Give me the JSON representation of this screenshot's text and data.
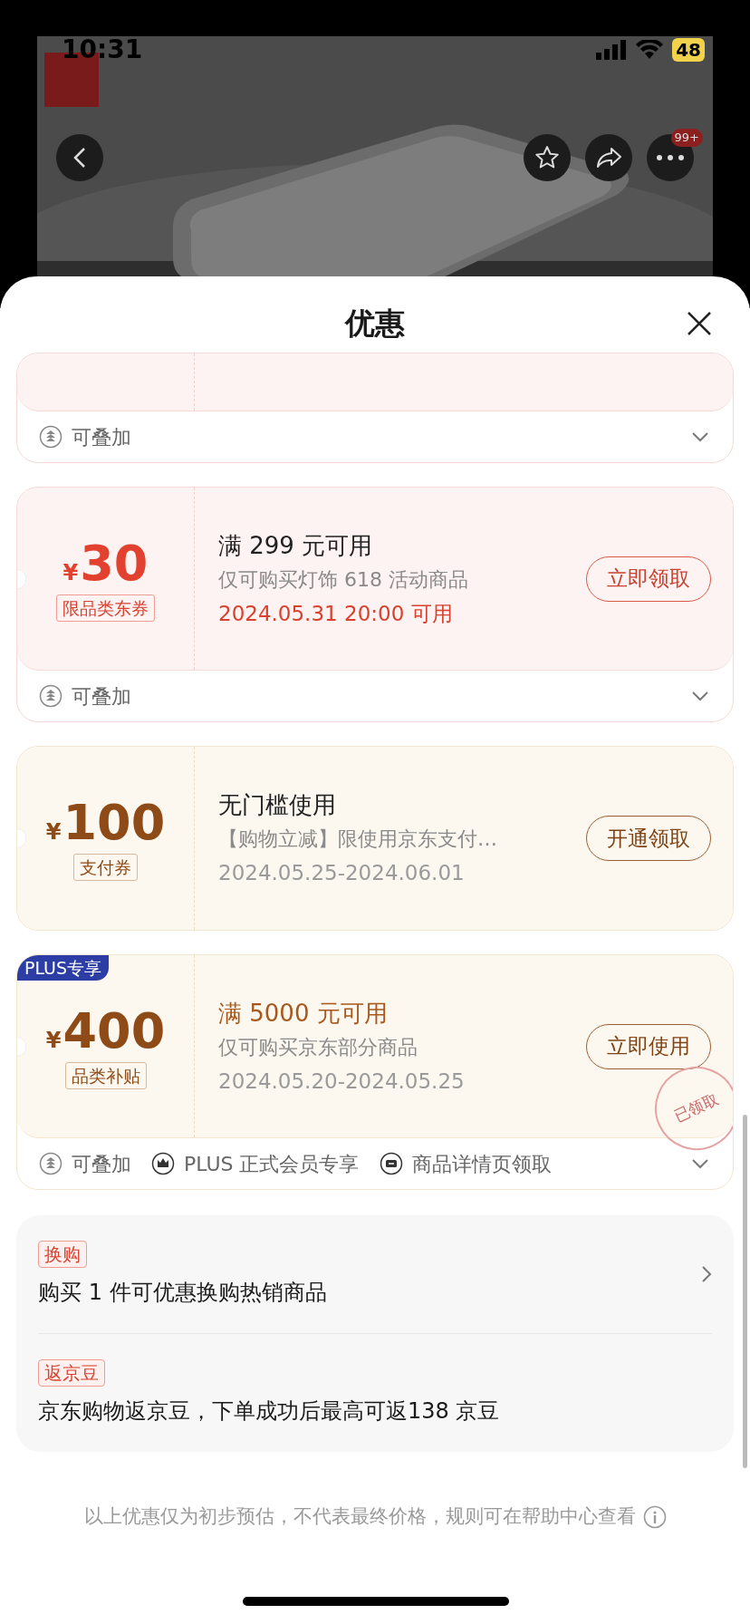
{
  "status_bar": {
    "time": "10:31",
    "battery": "48"
  },
  "product_header": {
    "more_badge": "99+"
  },
  "sheet": {
    "title": "优惠"
  },
  "coupons": [
    {
      "kind": "red",
      "partial": true,
      "tags": [
        {
          "kind": "stack",
          "text": "可叠加"
        }
      ],
      "expanded": false
    },
    {
      "kind": "red",
      "partial": false,
      "amount": "30",
      "currency": "¥",
      "type_label": "限品类东券",
      "title": "满 299 元可用",
      "title_highlight": false,
      "description": "仅可购买灯饰 618 活动商品",
      "date": "2024.05.31 20:00 可用",
      "date_highlight": true,
      "button": "立即领取",
      "tags": [
        {
          "kind": "stack",
          "text": "可叠加"
        }
      ],
      "expanded": false
    },
    {
      "kind": "gold",
      "partial": false,
      "amount": "100",
      "currency": "¥",
      "type_label": "支付券",
      "title": "无门槛使用",
      "title_highlight": false,
      "description": "【购物立减】限使用京东支付…",
      "date": "2024.05.25-2024.06.01",
      "date_highlight": false,
      "button": "开通领取"
    },
    {
      "kind": "gold",
      "partial": false,
      "badge": "PLUS专享",
      "amount": "400",
      "currency": "¥",
      "type_label": "品类补贴",
      "title": "满 5000 元可用",
      "title_highlight": true,
      "description": "仅可购买京东部分商品",
      "date": "2024.05.20-2024.05.25",
      "date_highlight": false,
      "button": "立即使用",
      "stamp": "已领取",
      "tags": [
        {
          "kind": "stack",
          "text": "可叠加"
        },
        {
          "kind": "crown",
          "text": "PLUS 正式会员专享"
        },
        {
          "kind": "ticket",
          "text": "商品详情页领取"
        }
      ],
      "expanded": false
    }
  ],
  "promotions": [
    {
      "tag": "换购",
      "text": "购买 1 件可优惠换购热销商品",
      "link": true
    },
    {
      "tag": "返京豆",
      "text": "京东购物返京豆，下单成功后最高可返138 京豆",
      "link": false
    }
  ],
  "disclaimer": "以上优惠仅为初步预估，不代表最终价格，规则可在帮助中心查看"
}
